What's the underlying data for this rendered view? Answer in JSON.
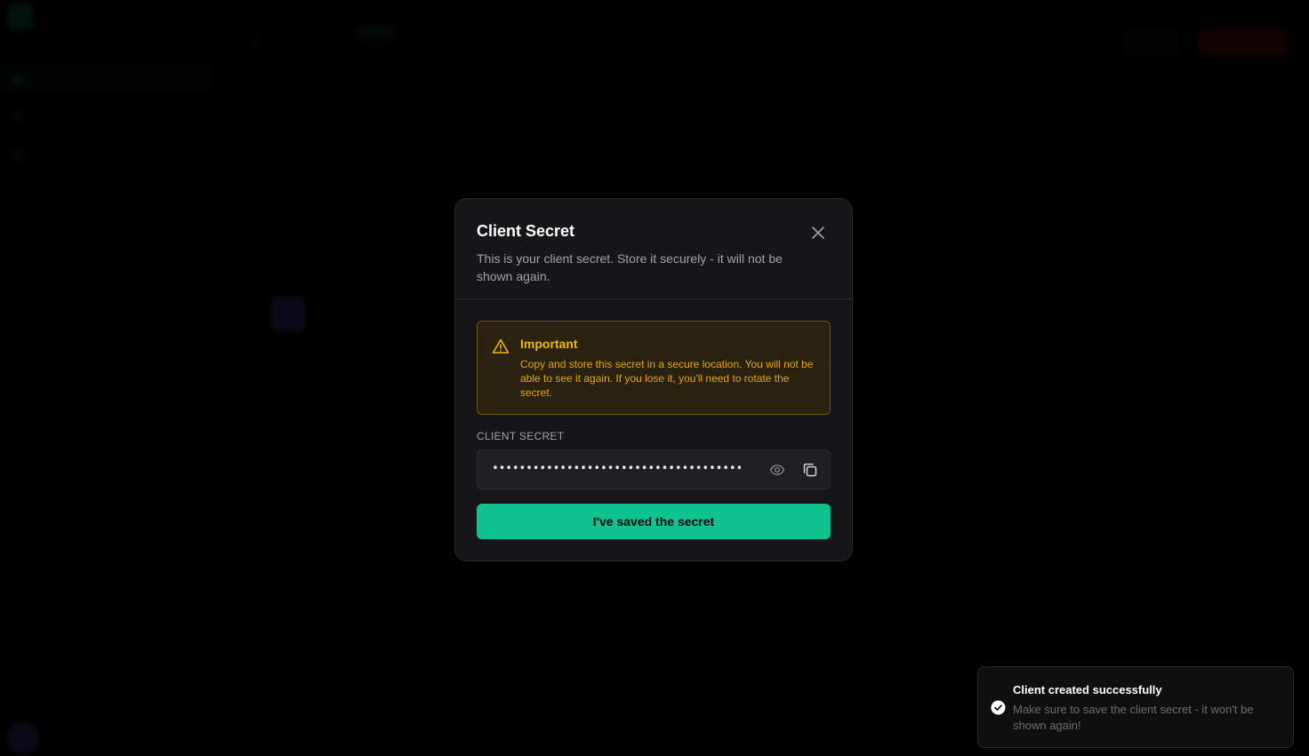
{
  "modal": {
    "title": "Client Secret",
    "description": "This is your client secret. Store it securely - it will not be shown again.",
    "warning": {
      "title": "Important",
      "text": "Copy and store this secret in a secure location. You will not be able to see it again. If you lose it, you'll need to rotate the secret."
    },
    "secret_label": "CLIENT SECRET",
    "secret_value_masked": "••••••••••••••••••••••••••••••••••••••••••••••••",
    "confirm_button": "I've saved the secret"
  },
  "toast": {
    "title": "Client created successfully",
    "description": "Make sure to save the client secret - it won't be shown again!"
  },
  "icons": {
    "close": "close-icon",
    "warning": "warning-triangle-icon",
    "eye": "eye-icon",
    "copy": "copy-icon",
    "toast_check": "check-circle-icon"
  },
  "colors": {
    "accent": "#10c38e",
    "warning_text": "#f5b50a",
    "warning_bg": "#2a2210",
    "warning_border": "#6b5410",
    "modal_bg": "#161618"
  }
}
